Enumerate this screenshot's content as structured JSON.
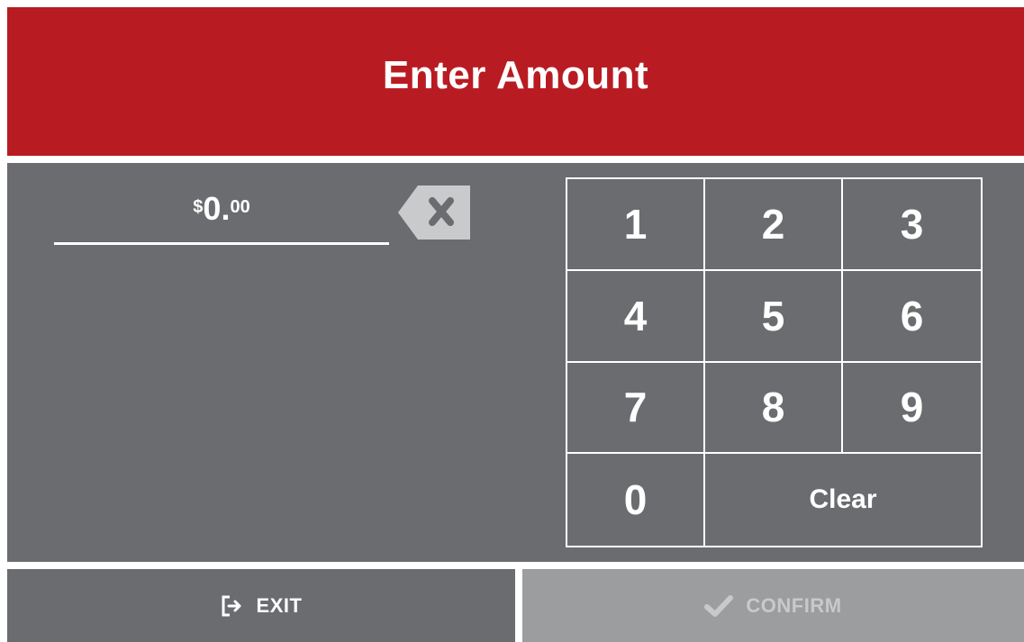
{
  "header": {
    "title": "Enter Amount"
  },
  "amount": {
    "currency_symbol": "$",
    "whole": "0.",
    "cents": "00"
  },
  "icons": {
    "backspace": "backspace-icon",
    "exit": "exit-icon",
    "confirm": "check-icon"
  },
  "keypad": {
    "keys": [
      "1",
      "2",
      "3",
      "4",
      "5",
      "6",
      "7",
      "8",
      "9",
      "0"
    ],
    "clear_label": "Clear"
  },
  "footer": {
    "exit_label": "EXIT",
    "confirm_label": "CONFIRM"
  },
  "colors": {
    "header": "#b81c22",
    "panel": "#6b6c6f",
    "confirm_disabled": "#9c9d9e"
  }
}
